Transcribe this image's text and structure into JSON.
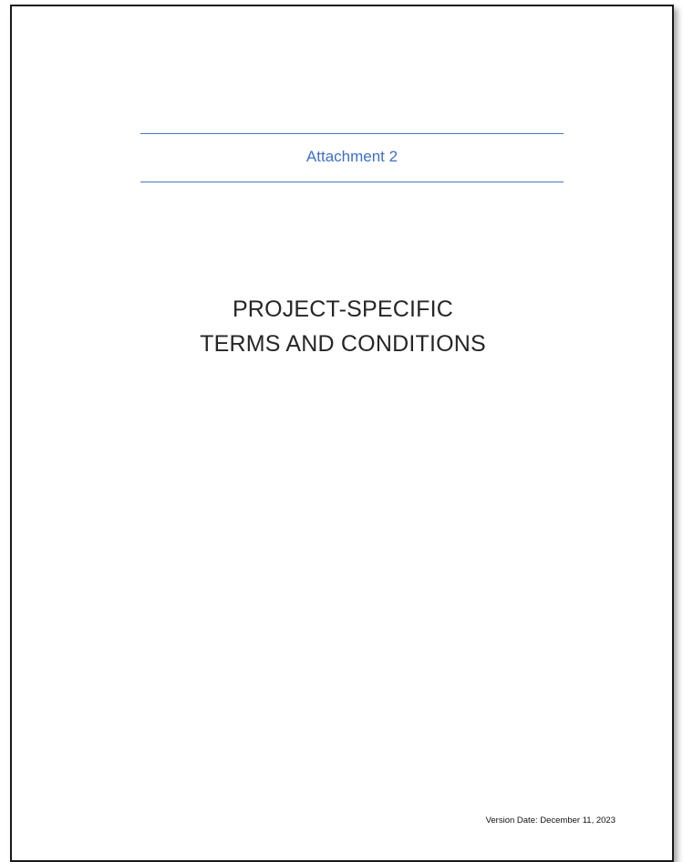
{
  "document": {
    "attachment_label": "Attachment 2",
    "title_line_1": "PROJECT-SPECIFIC",
    "title_line_2": "TERMS AND CONDITIONS",
    "version_date": "Version Date: December 11, 2023"
  },
  "colors": {
    "accent_blue": "#3f6fc6",
    "rule_blue": "#4a74c9",
    "title_text": "#262626",
    "page_border": "#1a1a1a"
  }
}
